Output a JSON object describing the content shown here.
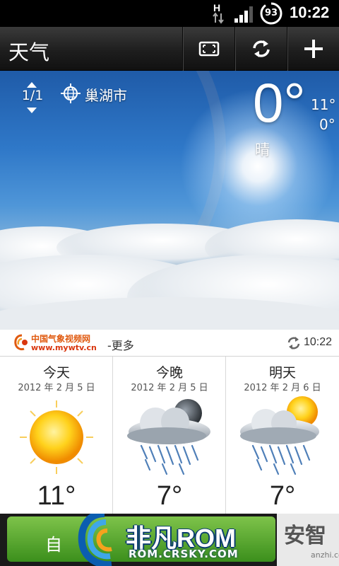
{
  "status_bar": {
    "network_type": "H",
    "battery_level": "93",
    "time": "10:22"
  },
  "title_bar": {
    "title": "天气",
    "icons": [
      "fullscreen-icon",
      "refresh-icon",
      "add-icon"
    ]
  },
  "current": {
    "page_indicator": "1/1",
    "city": "巢湖市",
    "temperature": "0°",
    "high": "11°",
    "low": "0°",
    "condition": "晴"
  },
  "source": {
    "provider_name": "中国气象视频网",
    "provider_url": "www.mywtv.cn",
    "more_label": "-更多",
    "updated_time": "10:22"
  },
  "forecast": [
    {
      "day": "今天",
      "date": "2012 年 2 月 5 日",
      "temp": "11°",
      "icon": "sunny-icon"
    },
    {
      "day": "今晚",
      "date": "2012 年 2 月 5 日",
      "temp": "7°",
      "icon": "night-rain-icon"
    },
    {
      "day": "明天",
      "date": "2012 年 2 月 6 日",
      "temp": "7°",
      "icon": "sun-rain-icon"
    }
  ],
  "bottom_banner": {
    "left_button": "自",
    "brand": "非凡ROM",
    "brand_url": "ROM.CRSKY.COM",
    "right_brand": "安智",
    "right_url": "anzhi.com"
  },
  "colors": {
    "sky_top": "#1f5ba8",
    "title_bar": "#2a2a2a",
    "logo_orange": "#e05a10",
    "banner_green": "#5aa832"
  }
}
